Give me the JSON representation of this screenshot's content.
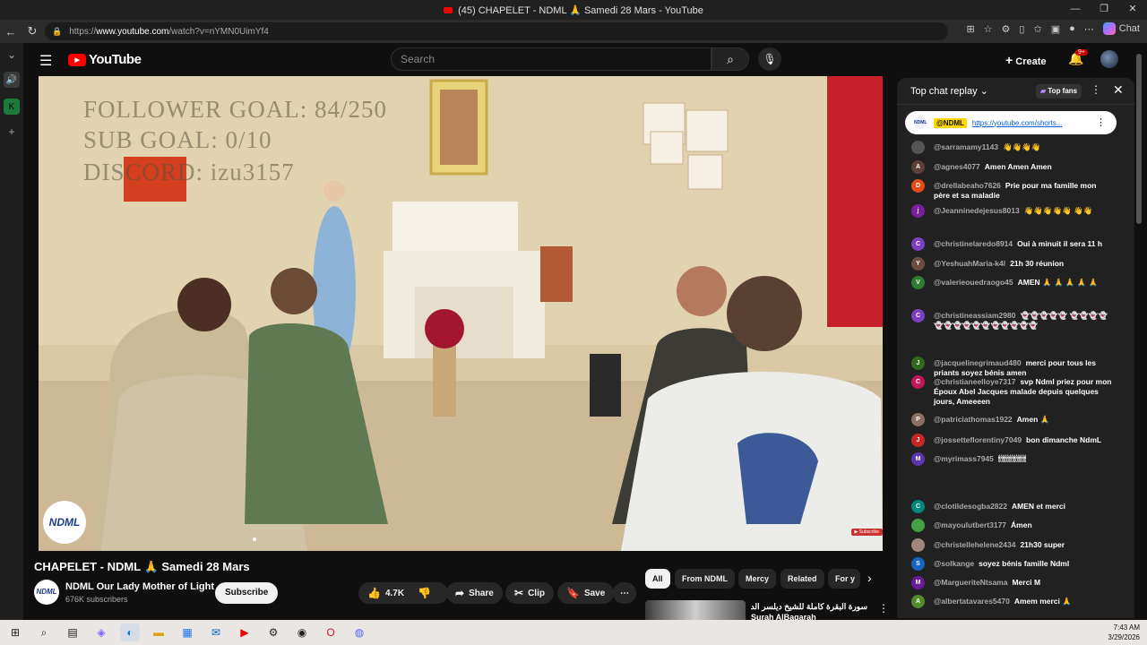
{
  "browser": {
    "window_title": "(45) CHAPELET - NDML 🙏 Samedi 28 Mars - YouTube",
    "url_prefix": "https://",
    "url_host": "www.youtube.com",
    "url_path": "/watch?v=nYMN0UimYf4",
    "chat_label": "Chat"
  },
  "header": {
    "logo_text": "YouTube",
    "search_placeholder": "Search",
    "create_label": "Create",
    "notifications_badge": "9+"
  },
  "video": {
    "overlay_line1": "FOLLOWER GOAL:  84/250",
    "overlay_line2": "SUB GOAL:  0/10",
    "overlay_line3": "DISCORD: izu3157",
    "channel_badge": "NDML",
    "title": "CHAPELET - NDML 🙏 Samedi 28 Mars",
    "channel_name": "NDML Our Lady Mother of Light",
    "subscribers": "676K subscribers",
    "subscribe_label": "Subscribe",
    "likes": "4.7K",
    "share_label": "Share",
    "clip_label": "Clip",
    "save_label": "Save"
  },
  "chips": [
    "All",
    "From NDML",
    "Mercy",
    "Related",
    "For y"
  ],
  "recommendation": {
    "title_line1": "سورة البقرة كاملة للشيخ ديلسر الدوسري |",
    "title_line2": "Surah AlBaqarah"
  },
  "chat": {
    "title": "Top chat replay",
    "top_fans_label": "Top fans",
    "pinned_user": "@NDML",
    "pinned_link": "https://youtube.com/shorts...",
    "messages": [
      {
        "user": "@sarramamy1143",
        "text": "👋👋👋👋",
        "initial": "",
        "color": "#555"
      },
      {
        "user": "@agnes4077",
        "text": "Amen Amen Amen",
        "initial": "A",
        "color": "#5d4037"
      },
      {
        "user": "@drellabeaho7626",
        "text": "Prie pour ma famille mon père et sa maladie",
        "initial": "D",
        "color": "#e64a19"
      },
      {
        "user": "@Jeanninedejesus8013",
        "text": "👋👋👋👋👋 👋👋",
        "initial": "j",
        "color": "#7b1fa2"
      },
      {
        "user": "@christinelaredo8914",
        "text": "Oui à minuit il sera 11 h",
        "initial": "C",
        "color": "#7b3fbf"
      },
      {
        "user": "@YeshuahMaria-k4l",
        "text": "21h 30 réunion",
        "initial": "Y",
        "color": "#6d4c41"
      },
      {
        "user": "@valerieouedraogo45",
        "text": "AMEN 🙏 🙏 🙏 🙏 🙏",
        "initial": "V",
        "color": "#2e7d32"
      },
      {
        "user": "@christineassiam2980",
        "text": "👻👻👻👻👻 👻👻👻👻👻👻👻👻👻👻👻👻👻👻👻",
        "initial": "C",
        "color": "#7b3fbf"
      },
      {
        "user": "@jacquelinegrimaud480",
        "text": "merci pour tous les priants soyez bénis amen",
        "initial": "J",
        "color": "#33691e"
      },
      {
        "user": "@christianeelloye7317",
        "text": "svp Ndml priez pour mon Époux Abel Jacques malade depuis quelques jours, Ameeeen",
        "initial": "C",
        "color": "#c2185b"
      },
      {
        "user": "@patriciathomas1922",
        "text": "Amen 🙏",
        "initial": "P",
        "color": "#8d6e63"
      },
      {
        "user": "@jossetteflorentiny7049",
        "text": "bon dimanche NdmL",
        "initial": "J",
        "color": "#c62828"
      },
      {
        "user": "@myrimass7945",
        "text": "🕯🕯🕯🕯🕯🕯🕯🕯🕯🕯🕯🕯🕯",
        "initial": "M",
        "color": "#5e35b1"
      },
      {
        "user": "@clotildesogba2822",
        "text": "AMEN et merci",
        "initial": "C",
        "color": "#00897b"
      },
      {
        "user": "@mayoulutbert3177",
        "text": "Ámen",
        "initial": "",
        "color": "#43a047"
      },
      {
        "user": "@christellehelene2434",
        "text": "21h30 super",
        "initial": "",
        "color": "#a1887f"
      },
      {
        "user": "@solkange",
        "text": "soyez bénis famille Ndml",
        "initial": "S",
        "color": "#1565c0"
      },
      {
        "user": "@MargueriteNtsama",
        "text": "Merci M",
        "initial": "M",
        "color": "#6a1b9a"
      },
      {
        "user": "@albertatavares5470",
        "text": "Amem merci 🙏",
        "initial": "A",
        "color": "#558b2f"
      }
    ]
  },
  "taskbar": {
    "time": "7:43 AM",
    "date": "3/29/2026"
  },
  "colors": {
    "accent": "#ff0000",
    "background": "#0f0f0f",
    "chat_background": "#212121"
  }
}
